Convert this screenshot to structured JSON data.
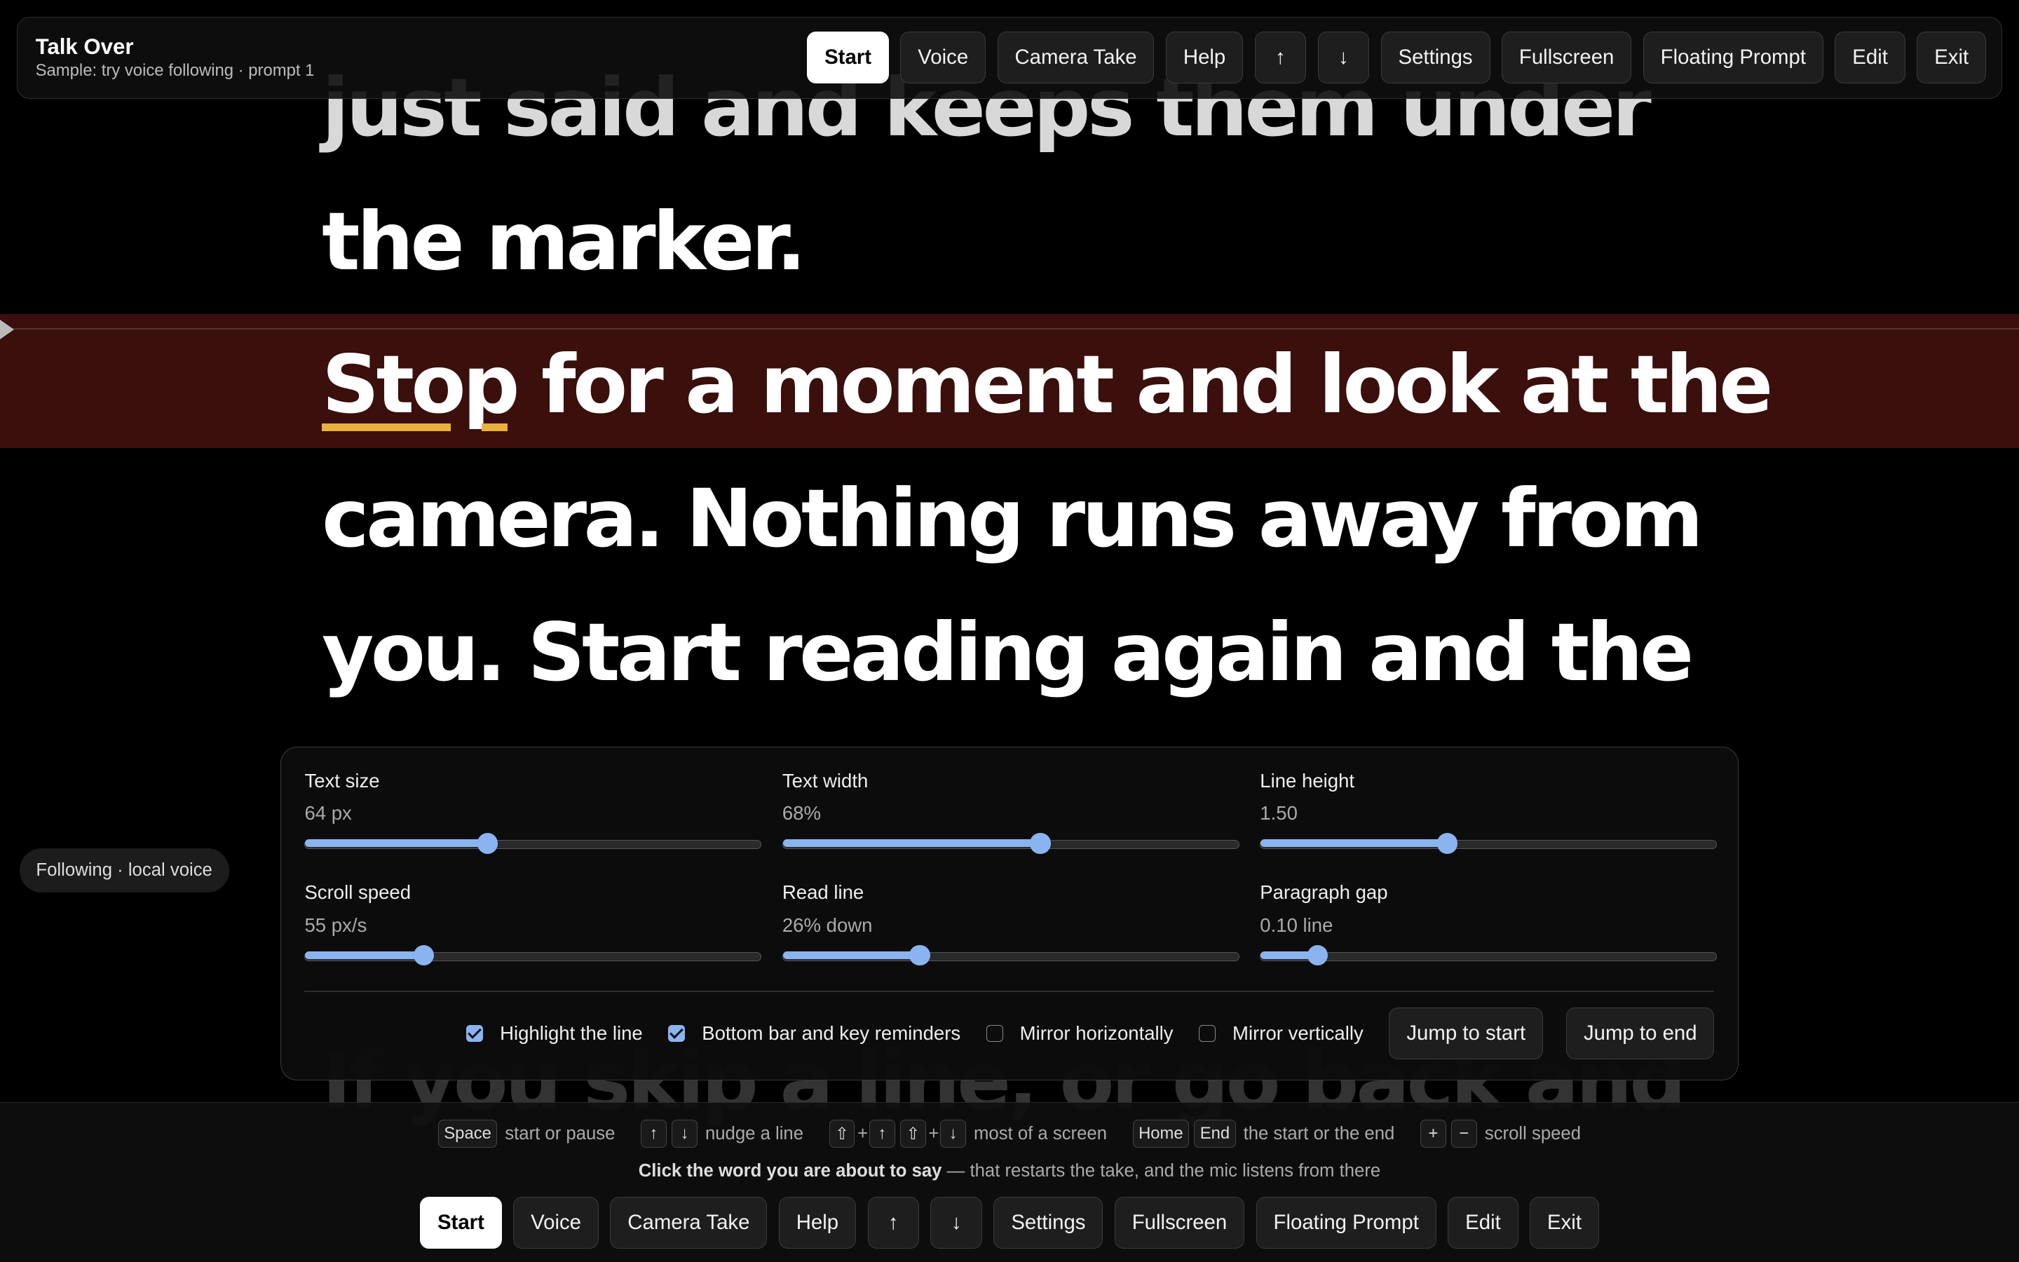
{
  "app": {
    "title": "Talk Over",
    "subtitle": "Sample: try voice following · prompt 1"
  },
  "toolbar": {
    "start": "Start",
    "voice": "Voice",
    "camera_take": "Camera Take",
    "help": "Help",
    "up": "↑",
    "down": "↓",
    "settings": "Settings",
    "fullscreen": "Fullscreen",
    "floating_prompt": "Floating Prompt",
    "edit": "Edit",
    "exit": "Exit"
  },
  "script": {
    "lines": [
      "just said and keeps them under",
      "the marker.",
      "for a moment and look at the",
      "camera. Nothing runs away from",
      "you. Start reading again and the",
      "If you skip a line, or go back and"
    ],
    "current_word": "Stop"
  },
  "status": "Following · local voice",
  "settings": {
    "text_size": {
      "label": "Text size",
      "value": "64 px",
      "fraction": 0.4
    },
    "text_width": {
      "label": "Text width",
      "value": "68%",
      "fraction": 0.565
    },
    "line_height": {
      "label": "Line height",
      "value": "1.50",
      "fraction": 0.41
    },
    "scroll_speed": {
      "label": "Scroll speed",
      "value": "55 px/s",
      "fraction": 0.26
    },
    "read_line": {
      "label": "Read line",
      "value": "26% down",
      "fraction": 0.3
    },
    "paragraph_gap": {
      "label": "Paragraph gap",
      "value": "0.10 line",
      "fraction": 0.125
    },
    "options": {
      "highlight_line": {
        "label": "Highlight the line",
        "checked": true
      },
      "bottom_bar": {
        "label": "Bottom bar and key reminders",
        "checked": true
      },
      "mirror_h": {
        "label": "Mirror horizontally",
        "checked": false
      },
      "mirror_v": {
        "label": "Mirror vertically",
        "checked": false
      }
    },
    "jump_start": "Jump to start",
    "jump_end": "Jump to end"
  },
  "keys": {
    "space": "Space",
    "space_desc": "start or pause",
    "up": "↑",
    "down": "↓",
    "nudge_desc": "nudge a line",
    "shift": "⇧",
    "plus_sign": "+",
    "screen_desc": "most of a screen",
    "home": "Home",
    "end": "End",
    "ends_desc": "the start or the end",
    "plus": "+",
    "minus": "−",
    "speed_desc": "scroll speed"
  },
  "hint": {
    "bold": "Click the word you are about to say",
    "rest": " — that restarts the take, and the mic listens from there"
  }
}
